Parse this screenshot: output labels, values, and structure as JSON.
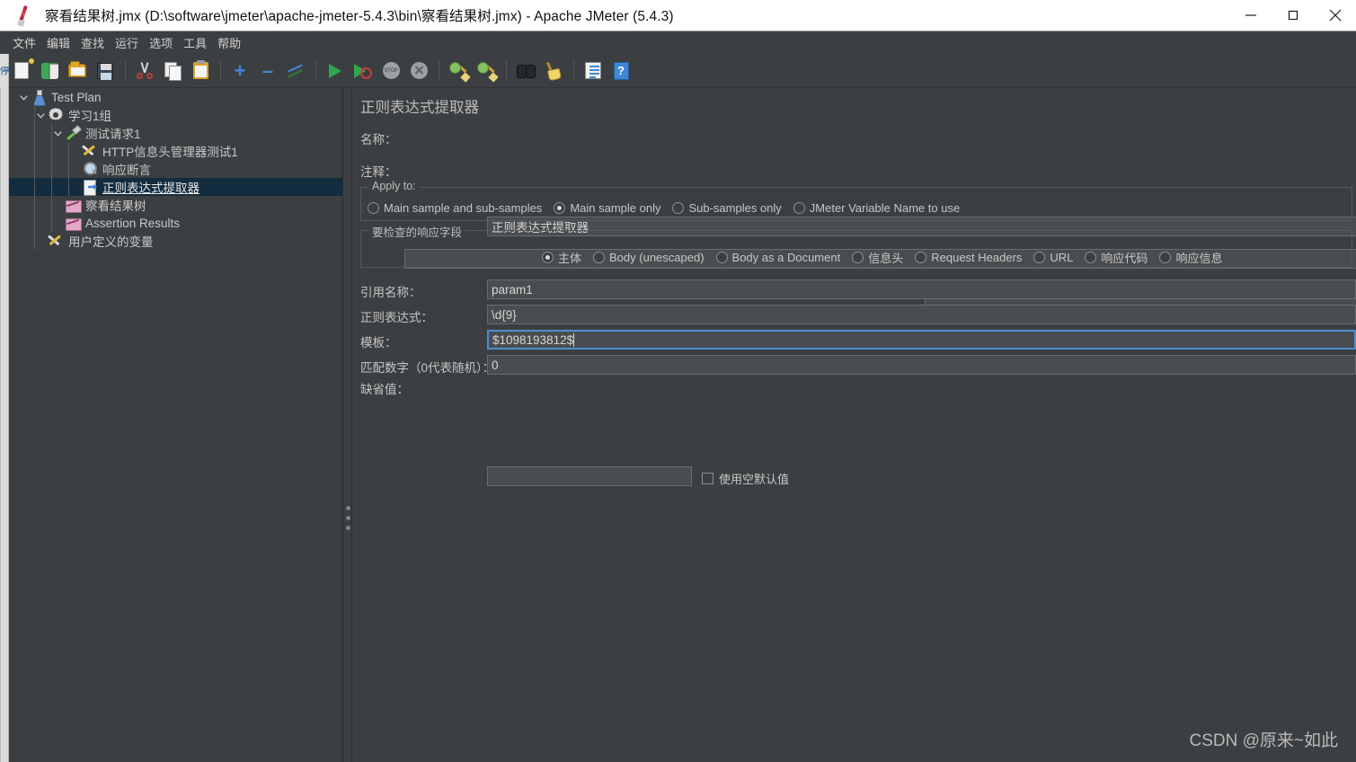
{
  "window": {
    "title": "察看结果树.jmx (D:\\software\\jmeter\\apache-jmeter-5.4.3\\bin\\察看结果树.jmx) - Apache JMeter (5.4.3)",
    "minimize_label": "—",
    "maximize_label": "□",
    "close_label": "✕",
    "app_icon": "jmeter-feather-icon"
  },
  "menubar": {
    "items": [
      {
        "label": "文件"
      },
      {
        "label": "编辑"
      },
      {
        "label": "查找"
      },
      {
        "label": "运行"
      },
      {
        "label": "选项"
      },
      {
        "label": "工具"
      },
      {
        "label": "帮助"
      }
    ]
  },
  "toolbar": {
    "buttons": [
      {
        "name": "new-icon",
        "kind": "newfile"
      },
      {
        "name": "templates-icon",
        "kind": "templates"
      },
      {
        "name": "open-icon",
        "kind": "open"
      },
      {
        "name": "save-icon",
        "kind": "save"
      },
      {
        "name": "sep",
        "kind": "sep"
      },
      {
        "name": "cut-icon",
        "kind": "cut"
      },
      {
        "name": "copy-icon",
        "kind": "copy"
      },
      {
        "name": "paste-icon",
        "kind": "paste"
      },
      {
        "name": "sep",
        "kind": "sep"
      },
      {
        "name": "expand-all-icon",
        "kind": "plus"
      },
      {
        "name": "collapse-all-icon",
        "kind": "minus"
      },
      {
        "name": "toggle-icon",
        "kind": "toggle"
      },
      {
        "name": "sep",
        "kind": "sep"
      },
      {
        "name": "start-icon",
        "kind": "play"
      },
      {
        "name": "start-no-pauses-icon",
        "kind": "playno"
      },
      {
        "name": "stop-icon",
        "kind": "stop"
      },
      {
        "name": "shutdown-icon",
        "kind": "shut"
      },
      {
        "name": "sep",
        "kind": "sep"
      },
      {
        "name": "clear-icon",
        "kind": "clear"
      },
      {
        "name": "clear-all-icon",
        "kind": "clear"
      },
      {
        "name": "sep",
        "kind": "sep"
      },
      {
        "name": "search-icon",
        "kind": "binoc"
      },
      {
        "name": "reset-search-icon",
        "kind": "broom"
      },
      {
        "name": "sep",
        "kind": "sep"
      },
      {
        "name": "function-helper-icon",
        "kind": "log"
      },
      {
        "name": "help-icon",
        "kind": "help"
      }
    ],
    "stop_text": "STOP",
    "help_text": "?"
  },
  "left_strip": {
    "glyph": "停"
  },
  "tree": {
    "nodes": [
      {
        "label": "Test Plan",
        "depth": 0,
        "icon": "test-plan-icon",
        "chevron": "down",
        "selected": false
      },
      {
        "label": "学习1组",
        "depth": 1,
        "icon": "thread-group-icon",
        "chevron": "down",
        "selected": false
      },
      {
        "label": "测试请求1",
        "depth": 2,
        "icon": "http-sampler-icon",
        "chevron": "down",
        "selected": false
      },
      {
        "label": "HTTP信息头管理器测试1",
        "depth": 3,
        "icon": "header-manager-icon",
        "chevron": "none",
        "selected": false
      },
      {
        "label": "响应断言",
        "depth": 3,
        "icon": "response-assertion-icon",
        "chevron": "none",
        "selected": false
      },
      {
        "label": "正则表达式提取器",
        "depth": 3,
        "icon": "regex-extractor-icon",
        "chevron": "none",
        "selected": true
      },
      {
        "label": "察看结果树",
        "depth": 2,
        "icon": "view-results-tree-icon",
        "chevron": "none",
        "selected": false
      },
      {
        "label": "Assertion Results",
        "depth": 2,
        "icon": "assertion-results-icon",
        "chevron": "none",
        "selected": false
      },
      {
        "label": "用户定义的变量",
        "depth": 1,
        "icon": "user-variables-icon",
        "chevron": "none",
        "selected": false
      }
    ]
  },
  "panel": {
    "title": "正则表达式提取器",
    "name_label": "名称：",
    "name_value": "正则表达式提取器",
    "comment_label": "注释：",
    "comment_value": "",
    "apply_to": {
      "group_title": "Apply to:",
      "options": [
        {
          "label": "Main sample and sub-samples",
          "selected": false
        },
        {
          "label": "Main sample only",
          "selected": true
        },
        {
          "label": "Sub-samples only",
          "selected": false
        },
        {
          "label": "JMeter Variable Name to use",
          "selected": false
        }
      ],
      "variable_value": ""
    },
    "field_to_check": {
      "group_title": "要检查的响应字段",
      "options": [
        {
          "label": "主体",
          "selected": true
        },
        {
          "label": "Body (unescaped)",
          "selected": false
        },
        {
          "label": "Body as a Document",
          "selected": false
        },
        {
          "label": "信息头",
          "selected": false
        },
        {
          "label": "Request Headers",
          "selected": false
        },
        {
          "label": "URL",
          "selected": false
        },
        {
          "label": "响应代码",
          "selected": false
        },
        {
          "label": "响应信息",
          "selected": false
        }
      ]
    },
    "fields": [
      {
        "label": "引用名称：",
        "value": "param1",
        "focused": false
      },
      {
        "label": "正则表达式：",
        "value": "\\d{9}",
        "focused": false
      },
      {
        "label": "模板：",
        "value": "$1098193812$",
        "focused": true,
        "caret_after": 12
      },
      {
        "label": "匹配数字（0代表随机）：",
        "value": "0",
        "focused": false
      }
    ],
    "default_value_label": "缺省值：",
    "default_value": "",
    "use_empty_default_label": "使用空默认值",
    "use_empty_default_checked": false
  },
  "watermark": {
    "text": "CSDN @原来~如此"
  },
  "colors": {
    "app_bg": "#3c3f41",
    "titlebar_bg": "#ffffff",
    "selection": "#132c3f",
    "field_bg": "#4a4d4f",
    "field_border": "#6a6d6f",
    "focus_border": "#4b8fd0",
    "text": "#c6c6c6"
  }
}
